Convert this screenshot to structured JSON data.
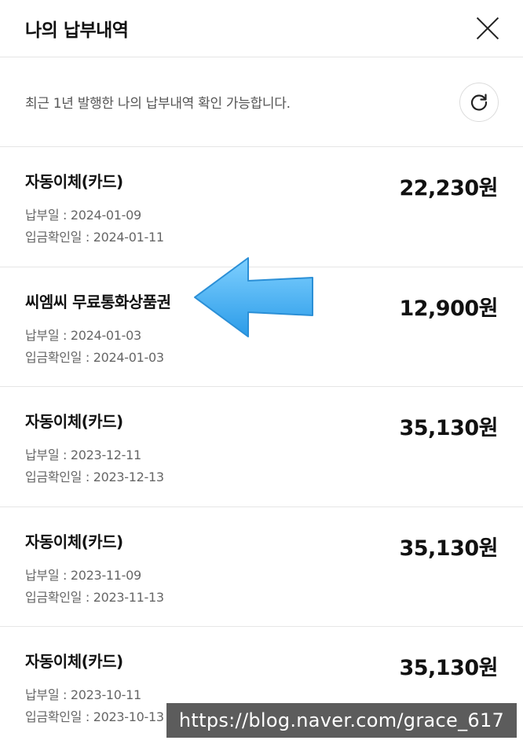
{
  "header": {
    "title": "나의 납부내역"
  },
  "notice": {
    "text": "최근 1년 발행한 나의 납부내역 확인 가능합니다."
  },
  "items": [
    {
      "title": "자동이체(카드)",
      "amount": "22,230원",
      "pay_line": "납부일 : 2024-01-09",
      "confirm_line": "입금확인일 : 2024-01-11"
    },
    {
      "title": "씨엠씨 무료통화상품권",
      "amount": "12,900원",
      "pay_line": "납부일 : 2024-01-03",
      "confirm_line": "입금확인일 : 2024-01-03"
    },
    {
      "title": "자동이체(카드)",
      "amount": "35,130원",
      "pay_line": "납부일 : 2023-12-11",
      "confirm_line": "입금확인일 : 2023-12-13"
    },
    {
      "title": "자동이체(카드)",
      "amount": "35,130원",
      "pay_line": "납부일 : 2023-11-09",
      "confirm_line": "입금확인일 : 2023-11-13"
    },
    {
      "title": "자동이체(카드)",
      "amount": "35,130원",
      "pay_line": "납부일 : 2023-10-11",
      "confirm_line": "입금확인일 : 2023-10-13"
    }
  ],
  "watermark": {
    "text": "https://blog.naver.com/grace_617"
  },
  "colors": {
    "arrow": "#4db3f5",
    "watermark_bg": "#464646"
  },
  "icons": {
    "close": "close-icon",
    "refresh": "refresh-icon",
    "arrow": "left-arrow-icon"
  }
}
